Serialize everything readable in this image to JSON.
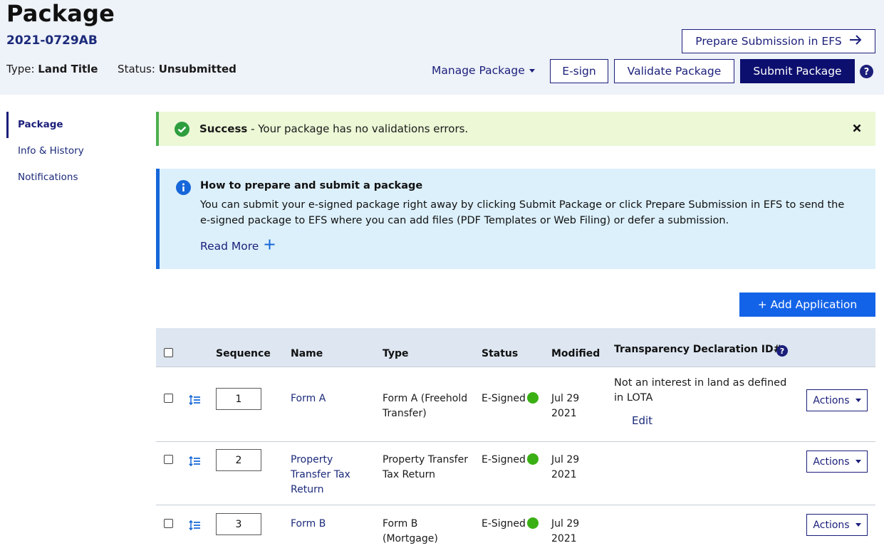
{
  "header": {
    "title": "Package",
    "package_id": "2021-0729AB",
    "type_label": "Type:",
    "type_value": "Land Title",
    "status_label": "Status:",
    "status_value": "Unsubmitted",
    "prepare_efs_label": "Prepare Submission in EFS",
    "manage_label": "Manage Package",
    "esign_label": "E-sign",
    "validate_label": "Validate Package",
    "submit_label": "Submit Package"
  },
  "sidebar": {
    "items": [
      {
        "label": "Package",
        "active": true
      },
      {
        "label": "Info & History",
        "active": false
      },
      {
        "label": "Notifications",
        "active": false
      }
    ]
  },
  "success_alert": {
    "title": "Success",
    "message": " - Your package has no validations errors."
  },
  "info_alert": {
    "title": "How to prepare and submit a package",
    "body": "You can submit your e-signed package right away by clicking Submit Package or click Prepare Submission in EFS to send the e-signed package to EFS where you can add files (PDF Templates or Web Filing) or defer a submission.",
    "read_more": "Read More"
  },
  "add_application_label": "+ Add Application",
  "table": {
    "columns": [
      "Sequence",
      "Name",
      "Type",
      "Status",
      "Modified",
      "Transparency Declaration ID#"
    ],
    "rows": [
      {
        "sequence": "1",
        "name": "Form A",
        "type": "Form A (Freehold Transfer)",
        "status": "E-Signed",
        "modified": "Jul 29 2021",
        "transparency": "Not an interest in land as defined in LOTA",
        "edit_label": "Edit",
        "actions_label": "Actions"
      },
      {
        "sequence": "2",
        "name": "Property Transfer Tax Return",
        "type": "Property Transfer Tax Return",
        "status": "E-Signed",
        "modified": "Jul 29 2021",
        "transparency": "",
        "actions_label": "Actions"
      },
      {
        "sequence": "3",
        "name": "Form B",
        "type": "Form B (Mortgage)",
        "status": "E-Signed",
        "modified": "Jul 29 2021",
        "transparency": "",
        "actions_label": "Actions"
      }
    ]
  },
  "colors": {
    "navy": "#1b1f7a",
    "header_bg": "#eef2f9",
    "success_bg": "#ecf8d6",
    "success_green": "#4caf50",
    "info_bg": "#dcf0fb",
    "info_blue": "#1667d9",
    "primary_blue": "#1363e8",
    "signed_dot": "#3ab015"
  },
  "icons": {
    "efs_arrow": "arrow-right-icon",
    "help": "question-circle-icon",
    "success": "check-circle-icon",
    "close": "close-icon",
    "info": "info-circle-icon",
    "read_more": "plus-icon",
    "reorder": "reorder-list-icon",
    "actions_caret": "caret-down-icon"
  }
}
